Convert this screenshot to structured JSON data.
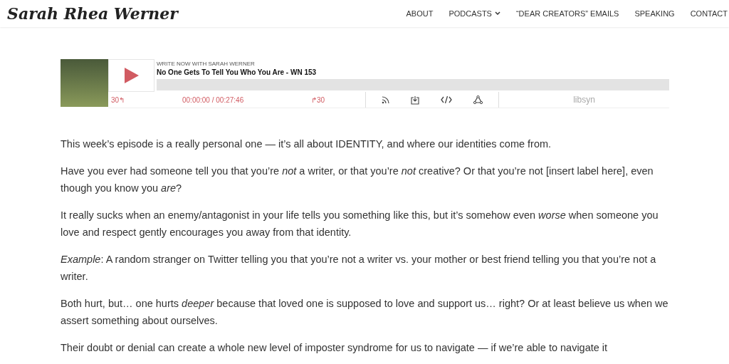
{
  "site_title": "Sarah Rhea Werner",
  "nav": [
    {
      "label": "ABOUT",
      "dropdown": false
    },
    {
      "label": "PODCASTS",
      "dropdown": true
    },
    {
      "label": "“DEAR CREATORS” EMAILS",
      "dropdown": false
    },
    {
      "label": "SPEAKING",
      "dropdown": false
    },
    {
      "label": "CONTACT",
      "dropdown": false
    }
  ],
  "player": {
    "show": "WRITE NOW WITH SARAH WERNER",
    "episode": "No One Gets To Tell You Who You Are - WN 153",
    "level": 0,
    "rewind": "30↰",
    "time": "00:00:00 / 00:27:46",
    "forward": "↱30",
    "logo": "libsyn"
  },
  "paragraphs": [
    "This week’s episode is a really personal one — it’s all about IDENTITY, and where our identities come from.",
    "Have you ever had someone tell you that you’re *not* a writer, or that you’re *not* creative? Or that you’re not [insert label here], even though you know you *are*?",
    "It really sucks when an enemy/antagonist in your life tells you something like this, but it’s somehow even *worse* when someone you love and respect gently encourages you away from that identity.",
    "*Example*: A random stranger on Twitter telling you that you’re not a writer vs. your mother or best friend telling you that you’re not a writer.",
    "Both hurt, but… one hurts *deeper* because that loved one is supposed to love and support us… right? Or at least believe us when we assert something about ourselves.",
    "Their doubt or denial can create a whole new level of imposter syndrome for us to navigate — if we’re able to navigate it"
  ]
}
